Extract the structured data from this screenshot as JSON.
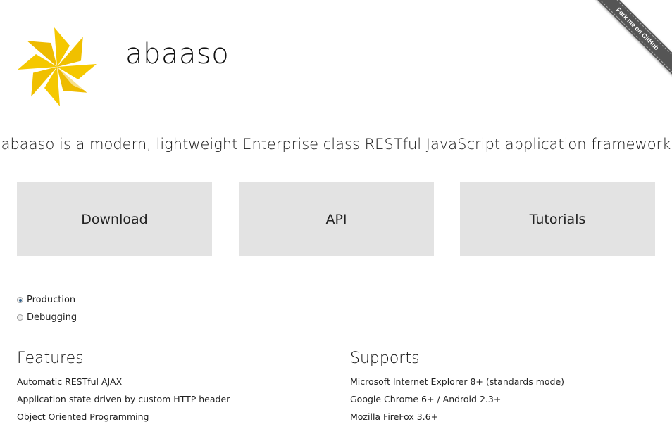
{
  "header": {
    "title": "abaaso",
    "fork_ribbon": "Fork me on GitHub"
  },
  "tagline": "abaaso is a modern, lightweight Enterprise class RESTful JavaScript application framework",
  "tiles": [
    {
      "label": "Download"
    },
    {
      "label": "API"
    },
    {
      "label": "Tutorials"
    }
  ],
  "build_options": [
    {
      "label": "Production",
      "checked": true
    },
    {
      "label": "Debugging",
      "checked": false
    }
  ],
  "features": {
    "heading": "Features",
    "items": [
      "Automatic RESTful AJAX",
      "Application state driven by custom HTTP header",
      "Object Oriented Programming"
    ]
  },
  "supports": {
    "heading": "Supports",
    "items": [
      "Microsoft Internet Explorer 8+ (standards mode)",
      "Google Chrome 6+ / Android 2.3+",
      "Mozilla FireFox 3.6+"
    ]
  },
  "colors": {
    "logo_yellow": "#f5c800",
    "logo_light": "#fde98a",
    "tile_bg": "#e3e3e3",
    "ribbon": "#555555"
  }
}
